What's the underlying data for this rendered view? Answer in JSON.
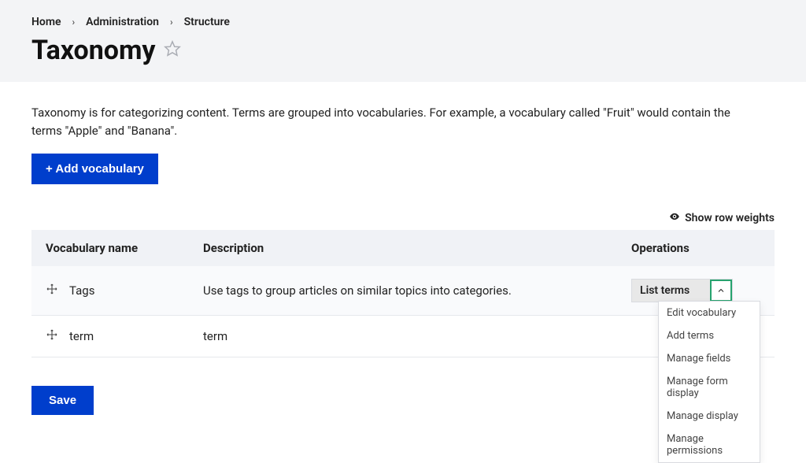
{
  "breadcrumb": {
    "home": "Home",
    "admin": "Administration",
    "structure": "Structure"
  },
  "page_title": "Taxonomy",
  "intro_text": "Taxonomy is for categorizing content. Terms are grouped into vocabularies. For example, a vocabulary called \"Fruit\" would contain the terms \"Apple\" and \"Banana\".",
  "add_vocabulary_label": "+ Add vocabulary",
  "show_row_weights": "Show row weights",
  "table": {
    "headers": {
      "name": "Vocabulary name",
      "description": "Description",
      "operations": "Operations"
    },
    "rows": [
      {
        "name": "Tags",
        "description": "Use tags to group articles on similar topics into categories.",
        "op_label": "List terms"
      },
      {
        "name": "term",
        "description": "term",
        "op_label": ""
      }
    ]
  },
  "dropdown": {
    "items": [
      "Edit vocabulary",
      "Add terms",
      "Manage fields",
      "Manage form display",
      "Manage display",
      "Manage permissions"
    ]
  },
  "save_label": "Save"
}
